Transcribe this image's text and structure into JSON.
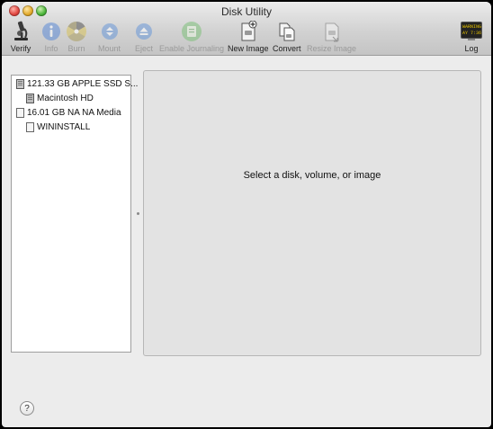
{
  "window": {
    "title": "Disk Utility"
  },
  "toolbar": {
    "verify": {
      "label": "Verify",
      "icon": "microscope-icon",
      "enabled": true
    },
    "info": {
      "label": "Info",
      "icon": "info-icon",
      "enabled": false
    },
    "burn": {
      "label": "Burn",
      "icon": "burn-icon",
      "enabled": false
    },
    "mount": {
      "label": "Mount",
      "icon": "mount-icon",
      "enabled": false
    },
    "eject": {
      "label": "Eject",
      "icon": "eject-icon",
      "enabled": false
    },
    "journaling": {
      "label": "Enable Journaling",
      "icon": "journaling-icon",
      "enabled": false
    },
    "new_image": {
      "label": "New Image",
      "icon": "new-image-icon",
      "enabled": true
    },
    "convert": {
      "label": "Convert",
      "icon": "convert-icon",
      "enabled": true
    },
    "resize_image": {
      "label": "Resize Image",
      "icon": "resize-image-icon",
      "enabled": false
    },
    "log": {
      "label": "Log",
      "icon": "log-icon",
      "enabled": true,
      "screen_text": [
        "WARNING",
        "AY 7:36"
      ]
    }
  },
  "sidebar": {
    "items": [
      {
        "label": "121.33 GB APPLE SSD S...",
        "type": "disk"
      },
      {
        "label": "Macintosh HD",
        "type": "volume"
      },
      {
        "label": "16.01 GB NA NA Media",
        "type": "disk"
      },
      {
        "label": "WININSTALL",
        "type": "volume"
      }
    ]
  },
  "detail": {
    "message": "Select a disk, volume, or image"
  },
  "help": {
    "label": "?"
  },
  "colors": {
    "window_bg": "#ececec",
    "detail_bg": "#e3e3e3",
    "accent_blue": "#4f86c9"
  }
}
